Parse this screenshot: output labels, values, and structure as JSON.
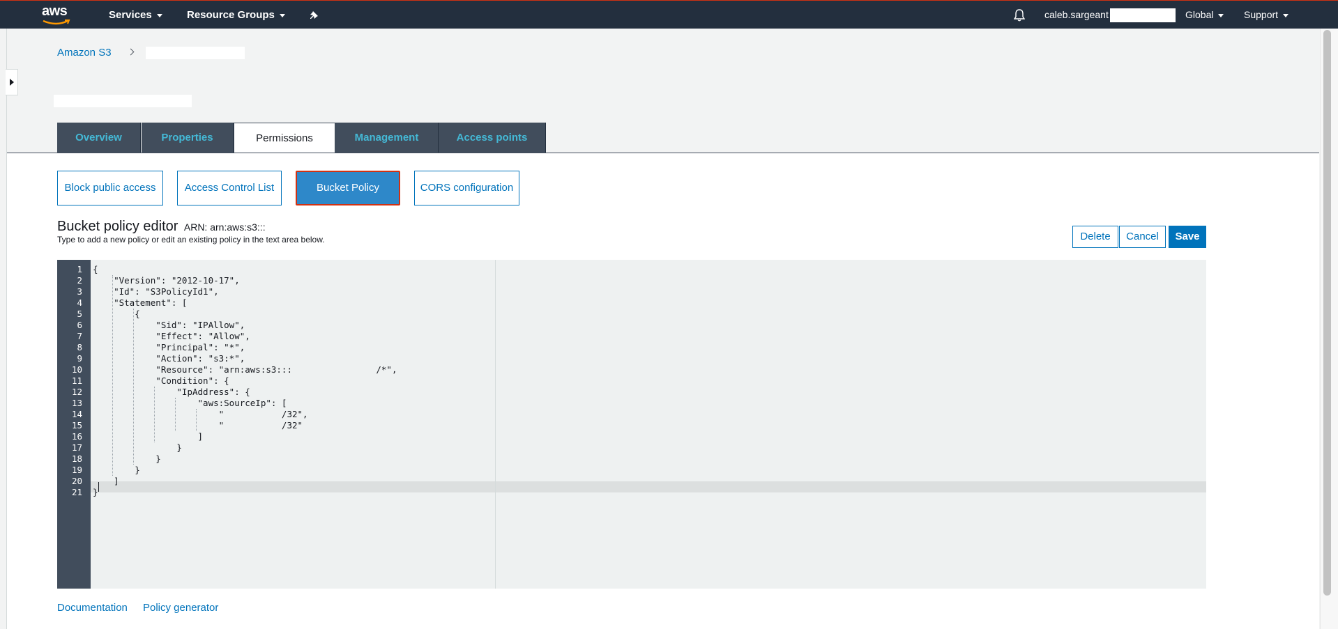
{
  "nav": {
    "logo": "aws",
    "services": "Services",
    "resource_groups": "Resource Groups",
    "user": "caleb.sargeant",
    "region": "Global",
    "support": "Support"
  },
  "breadcrumb": {
    "root": "Amazon S3"
  },
  "tabs": [
    "Overview",
    "Properties",
    "Permissions",
    "Management",
    "Access points"
  ],
  "active_tab": "Permissions",
  "subnav": [
    "Block public access",
    "Access Control List",
    "Bucket Policy",
    "CORS configuration"
  ],
  "active_subnav": "Bucket Policy",
  "editor_header": {
    "title": "Bucket policy editor",
    "arn": "ARN: arn:aws:s3:::",
    "hint": "Type to add a new policy or edit an existing policy in the text area below."
  },
  "actions": {
    "delete": "Delete",
    "cancel": "Cancel",
    "save": "Save"
  },
  "code_lines": [
    "{",
    "    \"Version\": \"2012-10-17\",",
    "    \"Id\": \"S3PolicyId1\",",
    "    \"Statement\": [",
    "        {",
    "            \"Sid\": \"IPAllow\",",
    "            \"Effect\": \"Allow\",",
    "            \"Principal\": \"*\",",
    "            \"Action\": \"s3:*\",",
    "            \"Resource\": \"arn:aws:s3:::                /*\",",
    "            \"Condition\": {",
    "                \"IpAddress\": {",
    "                    \"aws:SourceIp\": [",
    "                        \"           /32\",",
    "                        \"           /32\"",
    "                    ]",
    "                }",
    "            }",
    "        }",
    "    ]",
    "}"
  ],
  "footer_links": {
    "documentation": "Documentation",
    "policy_generator": "Policy generator"
  }
}
